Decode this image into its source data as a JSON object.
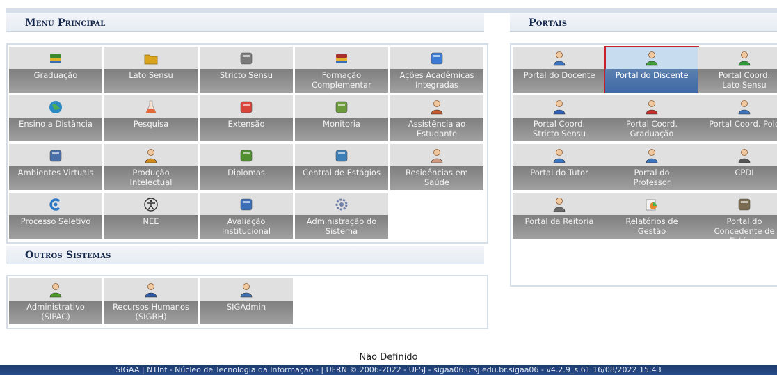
{
  "menu_principal": {
    "title": "Menu Principal",
    "tiles": [
      {
        "l1": "Graduação",
        "l2": "",
        "icon": "books-icon",
        "color": "#3d8a2e"
      },
      {
        "l1": "Lato Sensu",
        "l2": "",
        "icon": "folder-icon",
        "color": "#d9a41b"
      },
      {
        "l1": "Stricto Sensu",
        "l2": "",
        "icon": "safe-icon",
        "color": "#7a7a7a"
      },
      {
        "l1": "Formação",
        "l2": "Complementar",
        "icon": "book-icon",
        "color": "#a8302c"
      },
      {
        "l1": "Ações Acadêmicas",
        "l2": "Integradas",
        "icon": "puzzle-icon",
        "color": "#3b7bd6"
      },
      {
        "l1": "Ensino a Distância",
        "l2": "",
        "icon": "globe-icon",
        "color": "#2c8ac2"
      },
      {
        "l1": "Pesquisa",
        "l2": "",
        "icon": "flask-icon",
        "color": "#e2683a"
      },
      {
        "l1": "Extensão",
        "l2": "",
        "icon": "gift-icon",
        "color": "#d8443a"
      },
      {
        "l1": "Monitoria",
        "l2": "",
        "icon": "presentation-icon",
        "color": "#6a9a3a"
      },
      {
        "l1": "Assistência ao",
        "l2": "Estudante",
        "icon": "support-user-icon",
        "color": "#c65b2e"
      },
      {
        "l1": "Ambientes Virtuais",
        "l2": "",
        "icon": "network-icon",
        "color": "#4a6ea8"
      },
      {
        "l1": "Produção",
        "l2": "Intelectual",
        "icon": "user-check-icon",
        "color": "#d28a1e"
      },
      {
        "l1": "Diplomas",
        "l2": "",
        "icon": "diploma-icon",
        "color": "#4f8f2f"
      },
      {
        "l1": "Central de Estágios",
        "l2": "",
        "icon": "contacts-icon",
        "color": "#3a7fb8"
      },
      {
        "l1": "Residências em",
        "l2": "Saúde",
        "icon": "doctor-icon",
        "color": "#d09a80"
      },
      {
        "l1": "Processo Seletivo",
        "l2": "",
        "icon": "c-logo-icon",
        "color": "#2a78c8"
      },
      {
        "l1": "NEE",
        "l2": "",
        "icon": "accessibility-icon",
        "color": "#333333"
      },
      {
        "l1": "Avaliação",
        "l2": "Institucional",
        "icon": "checklist-icon",
        "color": "#3a6fb8"
      },
      {
        "l1": "Administração do",
        "l2": "Sistema",
        "icon": "gear-icon",
        "color": "#6f7faa"
      }
    ]
  },
  "outros_sistemas": {
    "title": "Outros Sistemas",
    "tiles": [
      {
        "l1": "Administrativo",
        "l2": "(SIPAC)",
        "icon": "puzzle-users-icon",
        "color": "#4c9a2a"
      },
      {
        "l1": "Recursos Humanos",
        "l2": "(SIGRH)",
        "icon": "user-icon",
        "color": "#2d5aa8"
      },
      {
        "l1": "SIGAdmin",
        "l2": "",
        "icon": "admin-user-icon",
        "color": "#3f6fb0"
      }
    ]
  },
  "portais": {
    "title": "Portais",
    "tiles": [
      {
        "l1": "Portal do Docente",
        "l2": "",
        "icon": "user-icon",
        "color": "#3c74c0",
        "selected": false
      },
      {
        "l1": "Portal do Discente",
        "l2": "",
        "icon": "user-icon",
        "color": "#3f9a3a",
        "selected": true
      },
      {
        "l1": "Portal Coord.",
        "l2": "Lato Sensu",
        "icon": "user-icon",
        "color": "#2e9a3a",
        "selected": false
      },
      {
        "l1": "Portal Coord.",
        "l2": "Stricto Sensu",
        "icon": "user-icon",
        "color": "#2f62b8",
        "selected": false
      },
      {
        "l1": "Portal Coord.",
        "l2": "Graduação",
        "icon": "user-icon",
        "color": "#c8302c",
        "selected": false
      },
      {
        "l1": "Portal Coord. Polo",
        "l2": "",
        "icon": "user-icon",
        "color": "#3c74c0",
        "selected": false
      },
      {
        "l1": "Portal do Tutor",
        "l2": "",
        "icon": "user-icon",
        "color": "#3c74c0",
        "selected": false
      },
      {
        "l1": "Portal do",
        "l2": "Professor",
        "icon": "user-icon",
        "color": "#3c74c0",
        "selected": false
      },
      {
        "l1": "CPDI",
        "l2": "",
        "icon": "user-icon",
        "color": "#555555",
        "selected": false
      },
      {
        "l1": "Portal da Reitoria",
        "l2": "",
        "icon": "user-icon",
        "color": "#6a6a6a",
        "selected": false
      },
      {
        "l1": "Relatórios de",
        "l2": "Gestão",
        "icon": "charts-icon",
        "color": "#e48a2a",
        "selected": false
      },
      {
        "l1": "Portal do",
        "l2": "Concedente de",
        "l3": "Estágio",
        "icon": "person-card-icon",
        "color": "#7a6a50",
        "selected": false
      }
    ]
  },
  "footer": {
    "status": "Não Definido",
    "text": "SIGAA | NTInf - Núcleo de Tecnologia da Informação - | UFRN © 2006-2022 - UFSJ - sigaa06.ufsj.edu.br.sigaa06 - v4.2.9_s.61 16/08/2022 15:43"
  }
}
